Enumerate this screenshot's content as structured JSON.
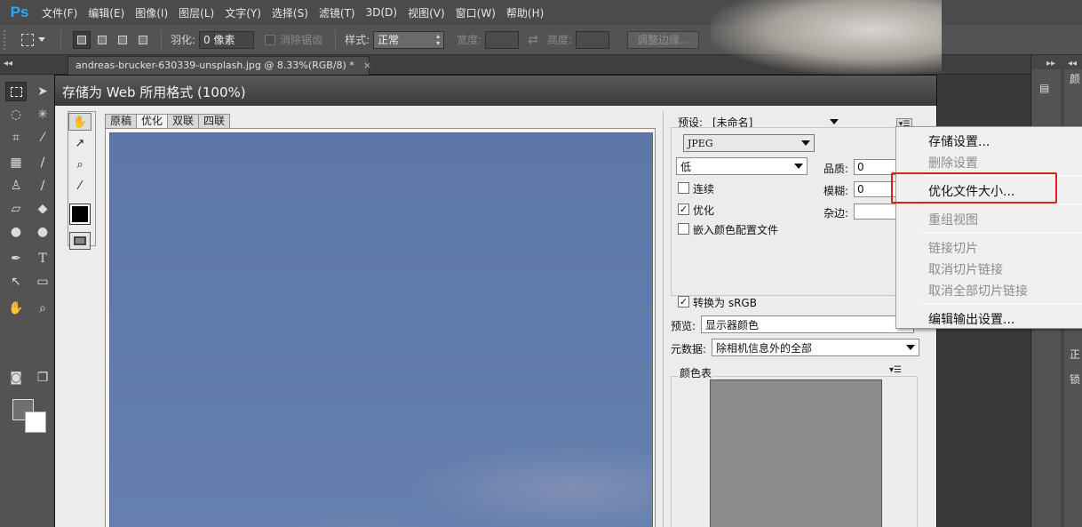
{
  "app": {
    "logo": "Ps",
    "menus": [
      "文件(F)",
      "编辑(E)",
      "图像(I)",
      "图层(L)",
      "文字(Y)",
      "选择(S)",
      "滤镜(T)",
      "3D(D)",
      "视图(V)",
      "窗口(W)",
      "帮助(H)"
    ]
  },
  "options": {
    "feather_label": "羽化:",
    "feather_value": "0 像素",
    "antialias_label": "消除锯齿",
    "style_label": "样式:",
    "style_value": "正常",
    "width_label": "宽度:",
    "height_label": "高度:",
    "refine_edge": "调整边缘..."
  },
  "document": {
    "tab_title": "andreas-brucker-630339-unsplash.jpg @ 8.33%(RGB/8) *",
    "close": "×"
  },
  "dialog": {
    "title": "存储为 Web 所用格式 (100%)",
    "view_tabs": [
      {
        "label": "原稿",
        "active": false
      },
      {
        "label": "优化",
        "active": true
      },
      {
        "label": "双联",
        "active": false
      },
      {
        "label": "四联",
        "active": false
      }
    ],
    "preset_label": "预设:",
    "preset_value": "[未命名]",
    "format_value": "JPEG",
    "quality_level": "低",
    "quality_label": "品质:",
    "quality_value": "0",
    "blur_label": "模糊:",
    "blur_value": "0",
    "matte_label": "杂边:",
    "progressive_label": "连续",
    "progressive_checked": false,
    "optimized_label": "优化",
    "optimized_checked": true,
    "embed_profile_label": "嵌入颜色配置文件",
    "embed_profile_checked": false,
    "convert_srgb_label": "转换为 sRGB",
    "convert_srgb_checked": true,
    "preview_label": "预览:",
    "preview_value": "显示器颜色",
    "metadata_label": "元数据:",
    "metadata_value": "除相机信息外的全部",
    "color_table_label": "颜色表",
    "check_mark": "✓"
  },
  "popup_menu": {
    "items": [
      {
        "label": "存储设置...",
        "disabled": false
      },
      {
        "label": "删除设置",
        "disabled": true
      },
      {
        "label": "优化文件大小...",
        "disabled": false
      },
      {
        "label": "重组视图",
        "disabled": true
      },
      {
        "label": "链接切片",
        "disabled": true
      },
      {
        "label": "取消切片链接",
        "disabled": true
      },
      {
        "label": "取消全部切片链接",
        "disabled": true
      },
      {
        "label": "编辑输出设置...",
        "disabled": false
      }
    ],
    "highlight_color": "#e02020"
  },
  "right_strip": {
    "labels": [
      "颜",
      "正",
      "锁"
    ]
  },
  "colors": {
    "accent": "#31a8ff",
    "image_blue": "#5f7bab"
  }
}
